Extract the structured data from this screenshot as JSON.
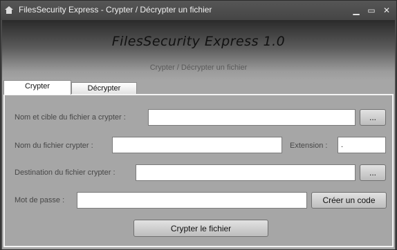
{
  "window": {
    "title": "FilesSecurity Express - Crypter / Décrypter un fichier",
    "controls": {
      "minimize": "▁",
      "maximize": "▭",
      "close": "✕"
    }
  },
  "header": {
    "app_title": "FilesSecurity Express 1.0",
    "subtitle": "Crypter / Décrypter un fichier"
  },
  "tabs": [
    {
      "label": "Crypter",
      "active": true
    },
    {
      "label": "Décrypter",
      "active": false
    }
  ],
  "form": {
    "source": {
      "label": "Nom et cible du fichier a crypter :",
      "value": "",
      "browse_label": "..."
    },
    "name": {
      "label": "Nom du fichier crypter :",
      "value": ""
    },
    "extension": {
      "label": "Extension :",
      "value": "."
    },
    "destination": {
      "label": "Destination du fichier crypter :",
      "value": "",
      "browse_label": "..."
    },
    "password": {
      "label": "Mot de passe :",
      "value": "",
      "generate_label": "Créer un code"
    },
    "submit_label": "Crypter le fichier"
  }
}
